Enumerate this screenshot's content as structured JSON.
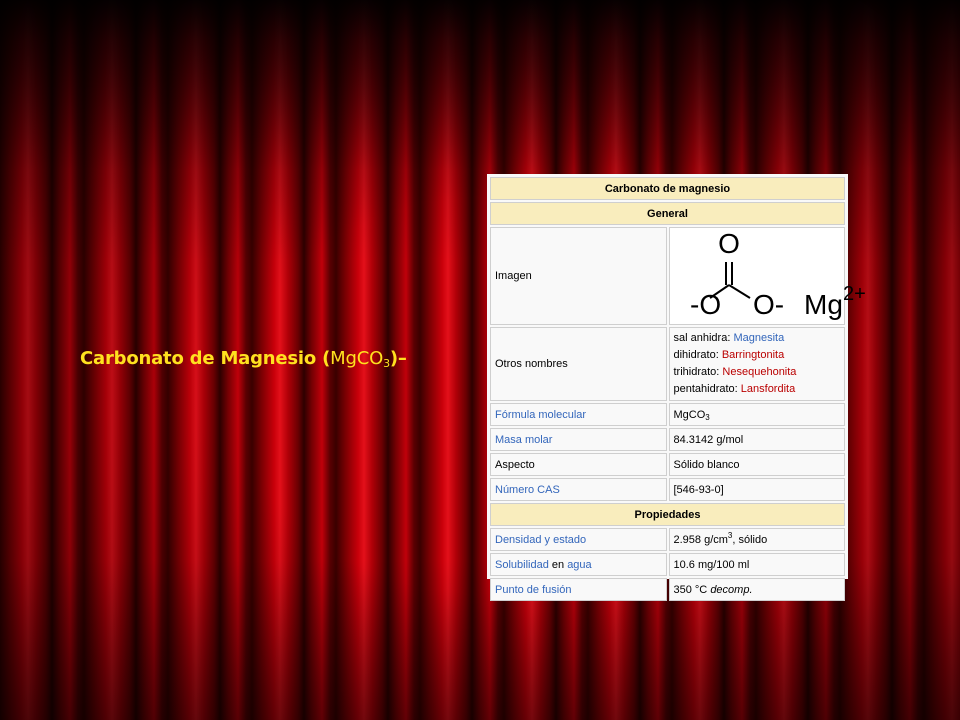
{
  "slide": {
    "title_main": "Carbonato de Magnesio (",
    "title_formula_main": "MgCO",
    "title_formula_sub": "3",
    "title_end": ")–"
  },
  "infobox": {
    "title": "Carbonato de magnesio",
    "section_general": "General",
    "imagen_label": "Imagen",
    "structure": {
      "atom_top": "O",
      "atom_left": "-O",
      "atom_right": "O-",
      "cation": "Mg",
      "cation_charge": "2+"
    },
    "otros_nombres_label": "Otros nombres",
    "otros_nombres": [
      {
        "prefix": "sal anhidra: ",
        "name": "Magnesita",
        "color": "#3366bb"
      },
      {
        "prefix": "dihidrato: ",
        "name": "Barringtonita",
        "color": "#ba0000"
      },
      {
        "prefix": "trihidrato: ",
        "name": "Nesequehonita",
        "color": "#ba0000"
      },
      {
        "prefix": "pentahidrato: ",
        "name": "Lansfordita",
        "color": "#ba0000"
      }
    ],
    "formula_label": "Fórmula molecular",
    "formula_main": "MgCO",
    "formula_sub": "3",
    "masa_label": "Masa molar",
    "masa_value": "84.3142 g/mol",
    "aspecto_label": "Aspecto",
    "aspecto_value": "Sólido blanco",
    "cas_label": "Número CAS",
    "cas_value": "[546-93-0]",
    "section_propiedades": "Propiedades",
    "densidad_label_a": "Densidad",
    "densidad_label_b": " y ",
    "densidad_label_c": "estado",
    "densidad_value_a": "2.958 g/cm",
    "densidad_value_sup": "3",
    "densidad_value_b": ", sólido",
    "solubilidad_label_a": "Solubilidad",
    "solubilidad_label_b": " en ",
    "solubilidad_label_c": "agua",
    "solubilidad_value": "10.6 mg/100 ml",
    "fusion_label": "Punto de fusión",
    "fusion_value_a": "350 °C ",
    "fusion_value_b": "decomp."
  }
}
